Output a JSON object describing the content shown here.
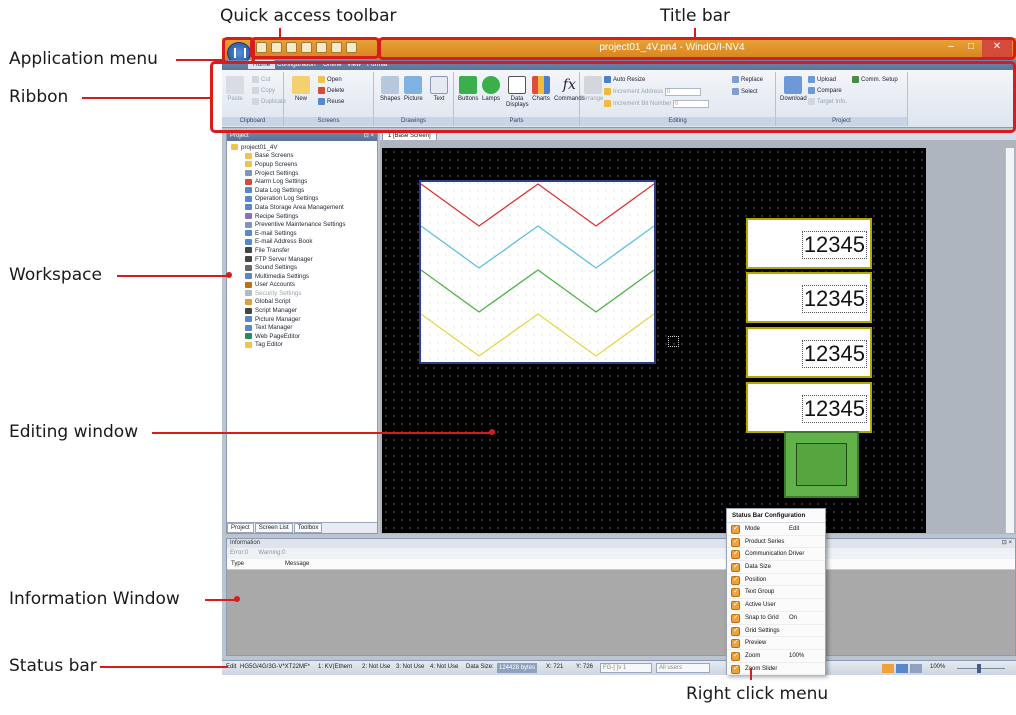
{
  "callouts": {
    "quick_access_toolbar": "Quick access toolbar",
    "title_bar": "Title bar",
    "application_menu": "Application menu",
    "ribbon": "Ribbon",
    "workspace": "Workspace",
    "editing_window": "Editing window",
    "information_window": "Information Window",
    "status_bar": "Status bar",
    "right_click_menu": "Right click menu"
  },
  "window": {
    "title": "project01_4V.pn4 - WindO/I-NV4",
    "minimize": "–",
    "maximize": "□",
    "close": "✕"
  },
  "ribbon_tabs": [
    "Home",
    "Configuration",
    "Online",
    "View",
    "Format"
  ],
  "ribbon": {
    "clipboard": {
      "label": "Clipboard",
      "paste": "Paste",
      "cut": "Cut",
      "copy": "Copy",
      "duplicate": "Duplicate"
    },
    "screens": {
      "label": "Screens",
      "new": "New",
      "open": "Open",
      "delete": "Delete",
      "reuse": "Reuse"
    },
    "drawings": {
      "label": "Drawings",
      "shapes": "Shapes",
      "picture": "Picture",
      "text": "Text"
    },
    "parts": {
      "label": "Parts",
      "buttons": "Buttons",
      "lamps": "Lamps",
      "data_displays": "Data Displays",
      "charts": "Charts",
      "commands": "Commands"
    },
    "editing": {
      "label": "Editing",
      "arrange": "Arrange",
      "auto_resize": "Auto Resize",
      "inc_address": "Increment Address",
      "inc_address_val": "0",
      "inc_bit": "Increment Bit Number",
      "inc_bit_val": "0",
      "replace": "Replace",
      "select": "Select"
    },
    "project": {
      "label": "Project",
      "download": "Download",
      "upload": "Upload",
      "compare": "Compare",
      "target_info": "Target Info.",
      "comm_setup": "Comm. Setup"
    }
  },
  "project_pane": {
    "title": "Project",
    "tree": [
      "project01_4V",
      "Base Screens",
      "Popup Screens",
      "Project Settings",
      "Alarm Log Settings",
      "Data Log Settings",
      "Operation Log Settings",
      "Data Storage Area Management",
      "Recipe Settings",
      "Preventive Maintenance Settings",
      "E-mail Settings",
      "E-mail Address Book",
      "File Transfer",
      "FTP Server Manager",
      "Sound Settings",
      "Multimedia Settings",
      "User Accounts",
      "Security Settings",
      "Global Script",
      "Script Manager",
      "Picture Manager",
      "Text Manager",
      "Web PageEditor",
      "Tag Editor"
    ],
    "tabs": [
      "Project",
      "Screen List",
      "Toolbox"
    ]
  },
  "editor": {
    "tab_label": "1 [Base Screen]",
    "displays": [
      "12345",
      "12345",
      "12345",
      "12345"
    ]
  },
  "info_window": {
    "title": "Information",
    "errors": "Error:0",
    "warnings": "Warning:0",
    "col_type": "Type",
    "col_message": "Message"
  },
  "status_bar": {
    "mode": "Edit",
    "series": "HG5G/4G/3G-V*XT22MF*",
    "comm1": "1: KV(Ethern",
    "comm2": "2: Not Use",
    "comm3": "3: Not Use",
    "comm4": "4: Not Use",
    "data_size_label": "Data Size:",
    "data_size_val": "124428 bytes",
    "pos_x": "X: 721",
    "pos_y": "Y: 726",
    "text_group": "FG-[ ]v 1",
    "active_user": "All users",
    "zoom": "100%"
  },
  "context_menu": {
    "title": "Status Bar Configuration",
    "items": [
      {
        "label": "Mode",
        "value": "Edit"
      },
      {
        "label": "Product Series",
        "value": ""
      },
      {
        "label": "Communication Driver",
        "value": ""
      },
      {
        "label": "Data Size",
        "value": ""
      },
      {
        "label": "Position",
        "value": ""
      },
      {
        "label": "Text Group",
        "value": ""
      },
      {
        "label": "Active User",
        "value": ""
      },
      {
        "label": "Snap to Grid",
        "value": "On"
      },
      {
        "label": "Grid Settings",
        "value": ""
      },
      {
        "label": "Preview",
        "value": ""
      },
      {
        "label": "Zoom",
        "value": "100%"
      },
      {
        "label": "Zoom Slider",
        "value": ""
      }
    ]
  },
  "colors": {
    "accent_red": "#d81b1b",
    "title_orange": "#d9821b",
    "wave_red": "#e03030",
    "wave_blue": "#5bc0e0",
    "wave_green": "#4ab040",
    "wave_yellow": "#e6d640"
  }
}
